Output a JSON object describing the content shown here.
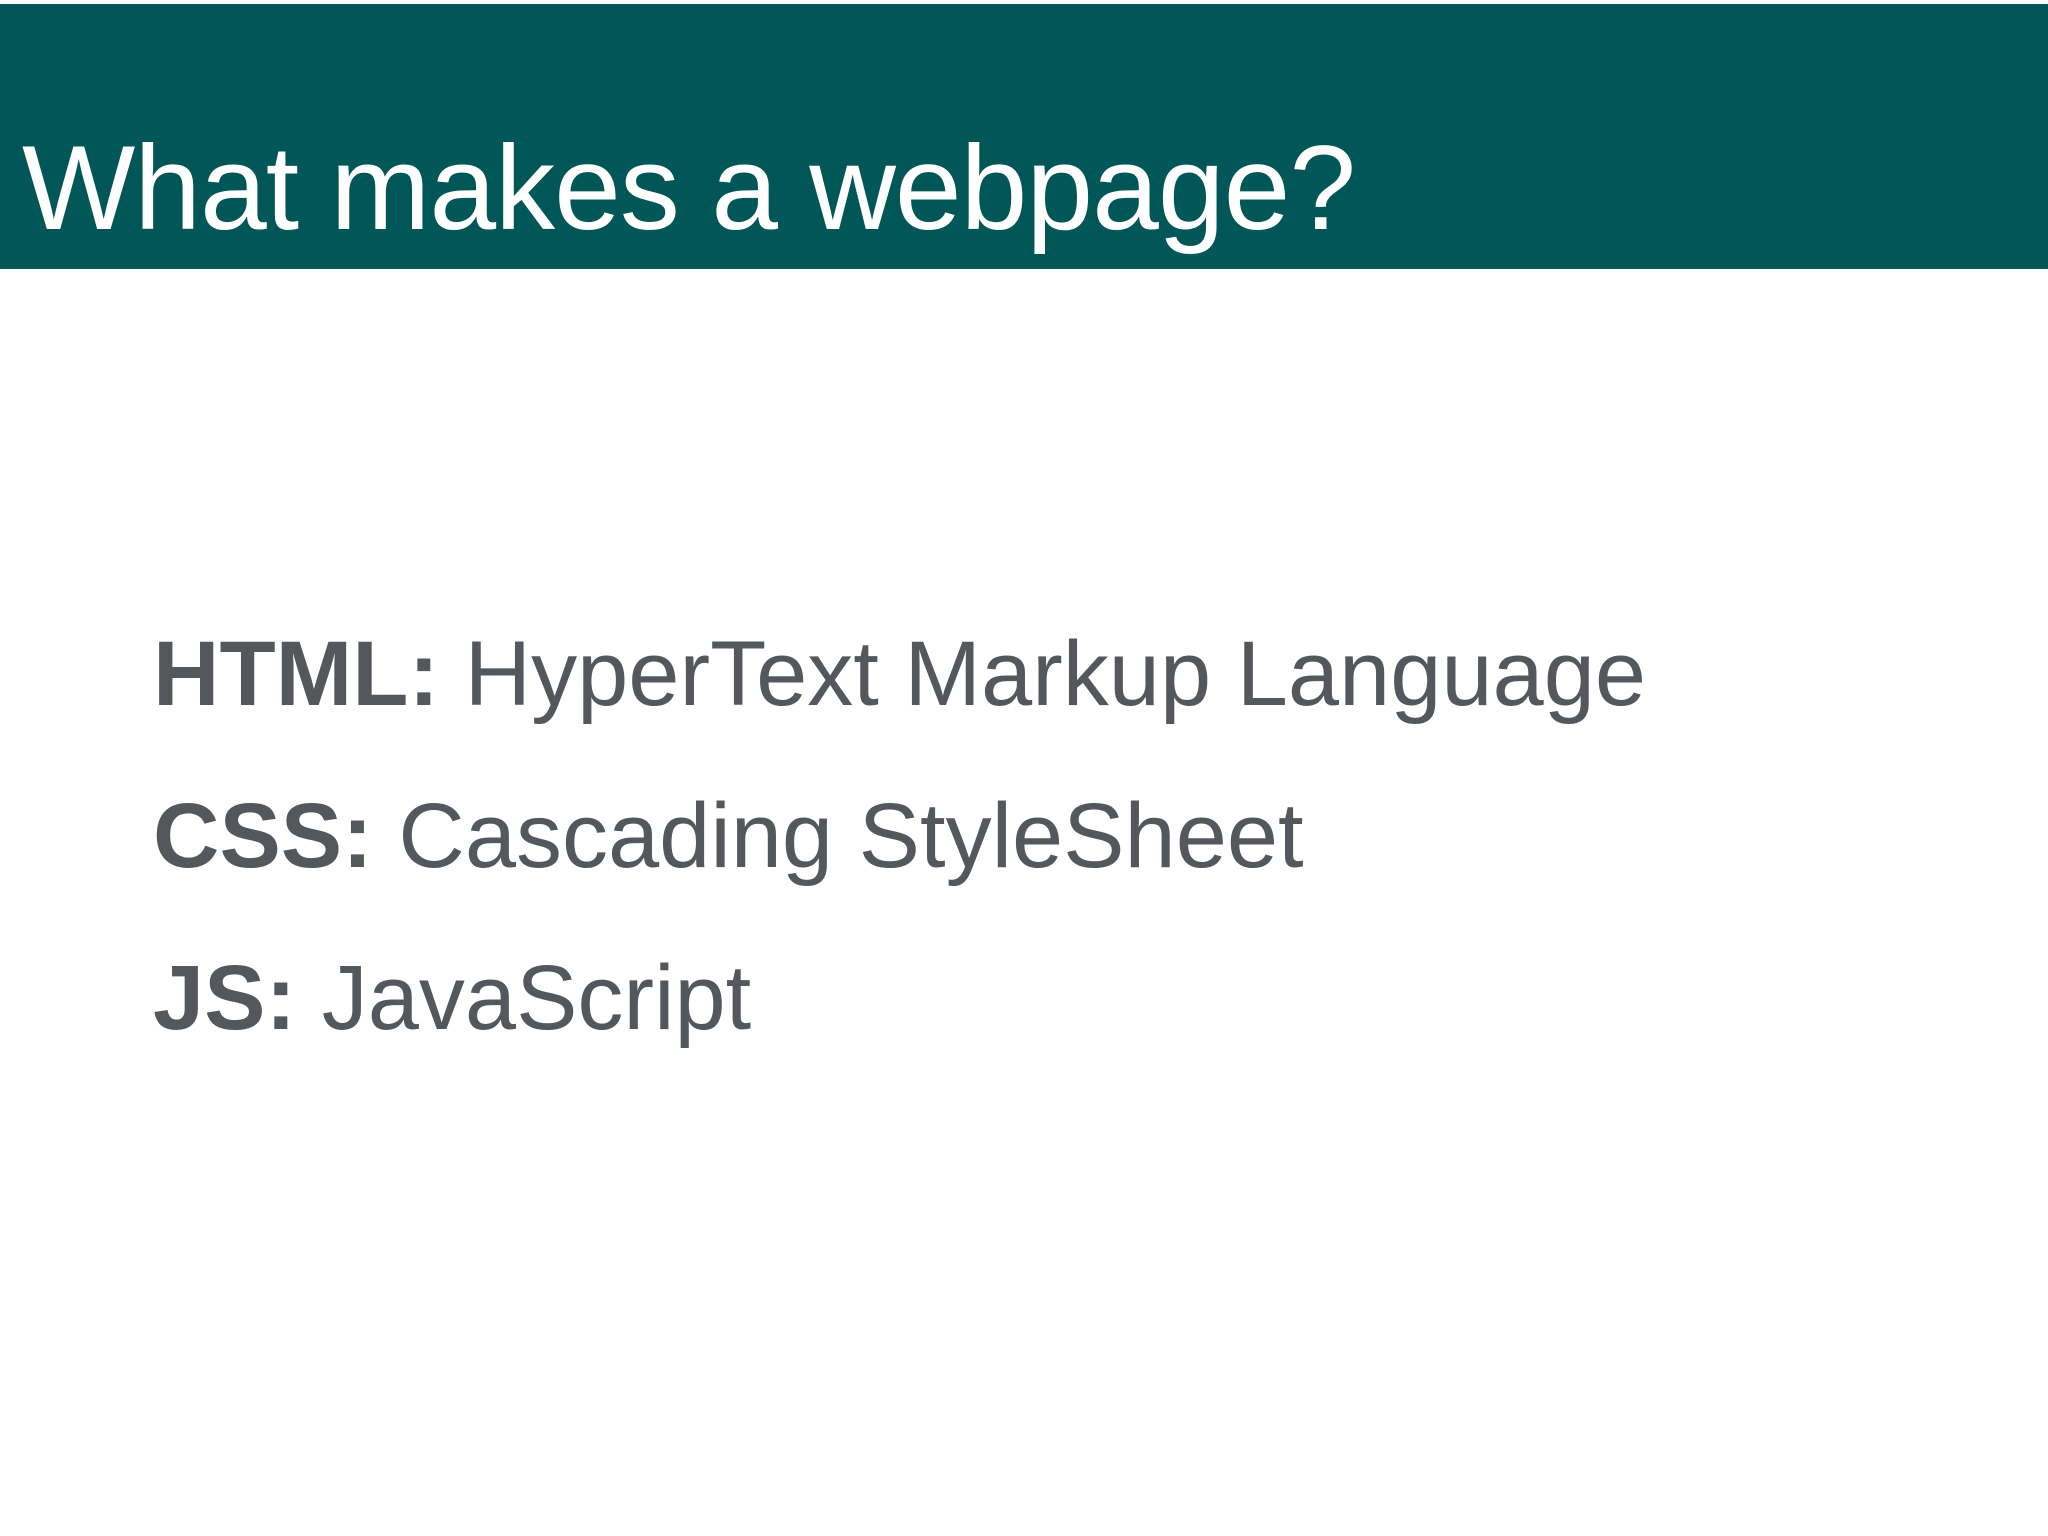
{
  "slide": {
    "title": "What makes a webpage?",
    "terms": [
      {
        "key": "HTML:",
        "value": "HyperText Markup Language"
      },
      {
        "key": "CSS:",
        "value": "Cascading StyleSheet"
      },
      {
        "key": "JS:",
        "value": "JavaScript"
      }
    ]
  },
  "colors": {
    "header_background": "#015757",
    "title_text": "#ffffff",
    "body_text": "#54585d",
    "slide_background": "#ffffff"
  }
}
